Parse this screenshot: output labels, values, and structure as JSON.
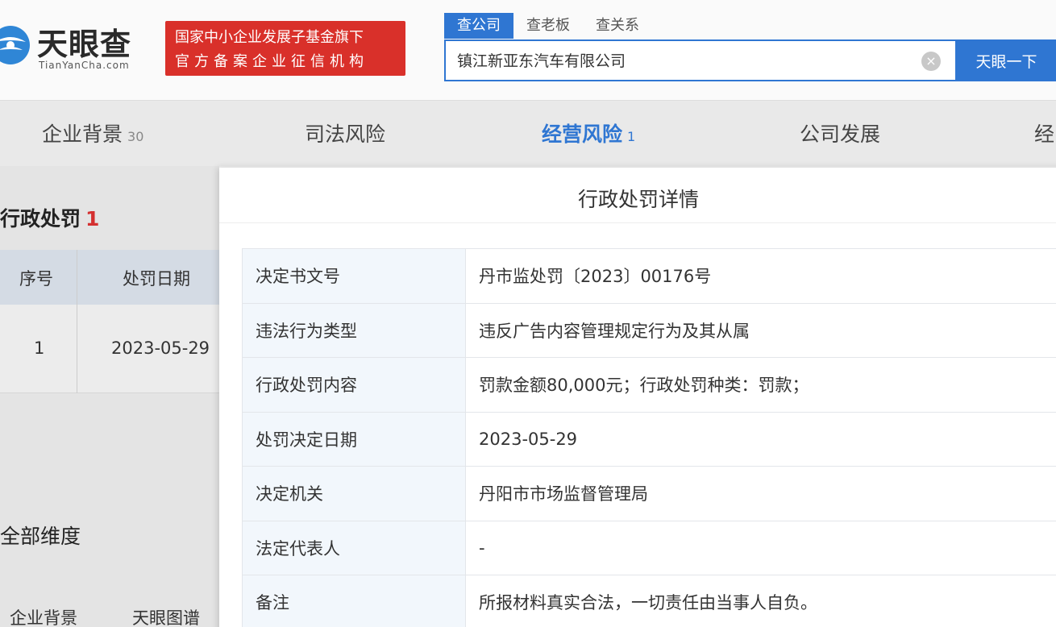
{
  "brand": {
    "name": "天眼查",
    "sub": "TianYanCha.com"
  },
  "gov_badge": {
    "line1": "国家中小企业发展子基金旗下",
    "line2": "官方备案企业征信机构"
  },
  "search": {
    "tabs": [
      "查公司",
      "查老板",
      "查关系"
    ],
    "active_tab": 0,
    "value": "镇江新亚东汽车有限公司",
    "button_label": "天眼一下"
  },
  "nav": [
    {
      "label": "企业背景",
      "count": "30"
    },
    {
      "label": "司法风险",
      "count": ""
    },
    {
      "label": "经营风险",
      "count": "1"
    },
    {
      "label": "公司发展",
      "count": ""
    },
    {
      "label": "经",
      "count": ""
    }
  ],
  "background": {
    "section_title": "行政处罚",
    "section_count": "1",
    "table_headers": [
      "序号",
      "处罚日期"
    ],
    "row": [
      "1",
      "2023-05-29"
    ],
    "all_dims": "全部维度",
    "dim_tabs": [
      "企业背景",
      "天眼图谱"
    ]
  },
  "modal": {
    "title": "行政处罚详情",
    "rows": [
      {
        "key": "决定书文号",
        "value": "丹市监处罚〔2023〕00176号"
      },
      {
        "key": "违法行为类型",
        "value": "违反广告内容管理规定行为及其从属"
      },
      {
        "key": "行政处罚内容",
        "value": "罚款金额80,000元；行政处罚种类：罚款；"
      },
      {
        "key": "处罚决定日期",
        "value": "2023-05-29"
      },
      {
        "key": "决定机关",
        "value": "丹阳市市场监督管理局"
      },
      {
        "key": "法定代表人",
        "value": "-"
      },
      {
        "key": "备注",
        "value": "所报材料真实合法，一切责任由当事人自负。"
      }
    ]
  },
  "colors": {
    "accent": "#2f76d2",
    "badge": "#d9302a",
    "count_red": "#d43030"
  }
}
